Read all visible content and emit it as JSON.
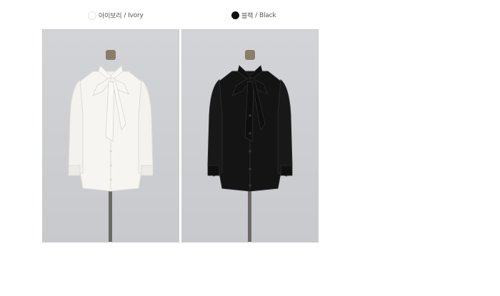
{
  "variants": [
    {
      "name_ko": "아이보리",
      "separator": " / ",
      "name_en": "Ivory",
      "swatch_color": "#f1f1f1",
      "garment_color": "#f6f5f1",
      "garment_shade": "#dcdad4"
    },
    {
      "name_ko": "블랙",
      "separator": " / ",
      "name_en": "Black",
      "swatch_color": "#111111",
      "garment_color": "#141414",
      "garment_shade": "#2a2a2a"
    }
  ],
  "colors": {
    "photo_background": "#cfd0d4",
    "stand_pole": "#6c6a66",
    "stand_cap": "#8a7d6c",
    "label_text": "#555555"
  }
}
